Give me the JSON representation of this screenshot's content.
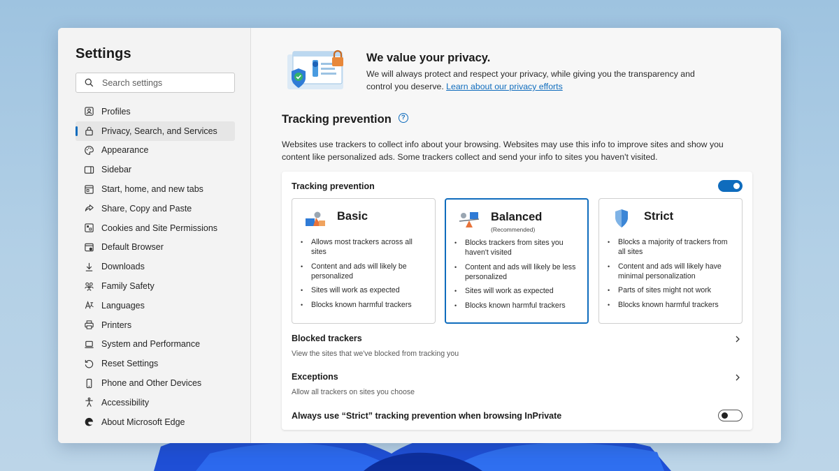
{
  "sidebar": {
    "title": "Settings",
    "search_placeholder": "Search settings",
    "items": [
      {
        "label": "Profiles",
        "icon": "profile-icon"
      },
      {
        "label": "Privacy, Search, and Services",
        "icon": "lock-icon",
        "active": true
      },
      {
        "label": "Appearance",
        "icon": "palette-icon"
      },
      {
        "label": "Sidebar",
        "icon": "sidebar-icon"
      },
      {
        "label": "Start, home, and new tabs",
        "icon": "home-tabs-icon"
      },
      {
        "label": "Share, Copy and Paste",
        "icon": "share-icon"
      },
      {
        "label": "Cookies and Site Permissions",
        "icon": "cookies-icon"
      },
      {
        "label": "Default Browser",
        "icon": "default-browser-icon"
      },
      {
        "label": "Downloads",
        "icon": "download-icon"
      },
      {
        "label": "Family Safety",
        "icon": "family-icon"
      },
      {
        "label": "Languages",
        "icon": "languages-icon"
      },
      {
        "label": "Printers",
        "icon": "printer-icon"
      },
      {
        "label": "System and Performance",
        "icon": "laptop-icon"
      },
      {
        "label": "Reset Settings",
        "icon": "reset-icon"
      },
      {
        "label": "Phone and Other Devices",
        "icon": "phone-icon"
      },
      {
        "label": "Accessibility",
        "icon": "accessibility-icon"
      },
      {
        "label": "About Microsoft Edge",
        "icon": "edge-icon"
      }
    ]
  },
  "hero": {
    "title": "We value your privacy.",
    "text": "We will always protect and respect your privacy, while giving you the transparency and control you deserve.",
    "link": "Learn about our privacy efforts"
  },
  "tracking": {
    "section_title": "Tracking prevention",
    "description": "Websites use trackers to collect info about your browsing. Websites may use this info to improve sites and show you content like personalized ads. Some trackers collect and send your info to sites you haven't visited.",
    "card_title": "Tracking prevention",
    "enabled": true,
    "options": [
      {
        "name": "Basic",
        "subtitle": "",
        "bullets": [
          "Allows most trackers across all sites",
          "Content and ads will likely be personalized",
          "Sites will work as expected",
          "Blocks known harmful trackers"
        ]
      },
      {
        "name": "Balanced",
        "subtitle": "(Recommended)",
        "selected": true,
        "bullets": [
          "Blocks trackers from sites you haven't visited",
          "Content and ads will likely be less personalized",
          "Sites will work as expected",
          "Blocks known harmful trackers"
        ]
      },
      {
        "name": "Strict",
        "subtitle": "",
        "bullets": [
          "Blocks a majority of trackers from all sites",
          "Content and ads will likely have minimal personalization",
          "Parts of sites might not work",
          "Blocks known harmful trackers"
        ]
      }
    ],
    "blocked": {
      "title": "Blocked trackers",
      "subtitle": "View the sites that we've blocked from tracking you"
    },
    "exceptions": {
      "title": "Exceptions",
      "subtitle": "Allow all trackers on sites you choose"
    },
    "inprivate": {
      "label": "Always use “Strict” tracking prevention when browsing InPrivate",
      "enabled": false
    }
  },
  "colors": {
    "accent": "#0f6cbd",
    "window_bg": "#f7f7f7",
    "sidebar_bg": "#f3f3f3"
  }
}
